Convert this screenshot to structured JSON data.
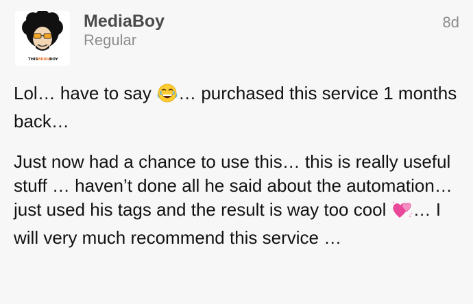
{
  "post": {
    "username": "MediaBoy",
    "user_title": "Regular",
    "date": "8d",
    "avatar": {
      "label_this": "THIS",
      "label_media": "MEDIA",
      "label_boy": "BOY",
      "bg_color": "#ffffff",
      "hair_color": "#111111",
      "skin_color": "#f2d5b3",
      "glasses_color": "#f5a623"
    },
    "paragraph1": {
      "before_emoji": "Lol… have to say ",
      "emoji_name": "face-with-tears-of-joy-icon",
      "after_emoji": "… purchased this service 1 months back…"
    },
    "paragraph2": {
      "before_emoji": "Just now had a chance to use this… this is really useful stuff … haven’t done all he said about the automation… just used his tags and the result is way too cool ",
      "emoji_name": "two-hearts-icon",
      "after_emoji": "… I will very much recommend this service …"
    }
  }
}
